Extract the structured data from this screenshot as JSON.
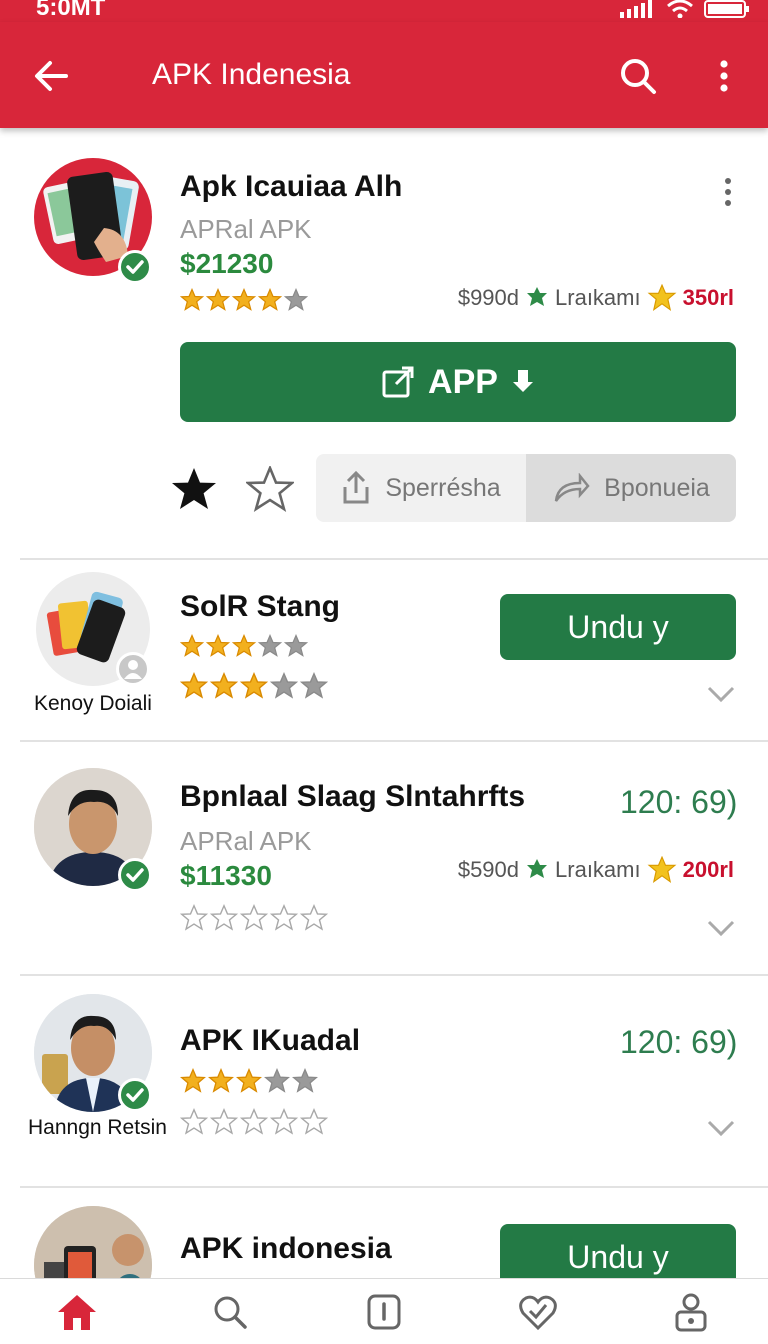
{
  "status_bar": {
    "time": "5:0MT"
  },
  "header": {
    "title": "APK Indenesia"
  },
  "featured": {
    "name": "Apk Icauiaa Alh",
    "subtitle": "APRal APK",
    "price": "$21230",
    "rating": 4,
    "meta_price": "$990d",
    "meta_tag": "Lraıkamı",
    "meta_count": "350rl",
    "primary_button": "APP",
    "action_left": "Sperrésha",
    "action_right": "Bponueia"
  },
  "items": [
    {
      "name": "SolR Stang",
      "caption": "Kenoy Doiali",
      "rating": 3,
      "rating2": 3,
      "button": "Undu y"
    },
    {
      "name": "Bpnlaal Slaag Slntahrfts",
      "subtitle": "APRal APK",
      "price": "$11330",
      "count": "120: 69)",
      "meta_price": "$590d",
      "meta_tag": "Lraıkamı",
      "meta_count": "200rl",
      "rating": 0
    },
    {
      "name": "APK IKuadal",
      "caption": "Hanngn Retsin",
      "count": "120: 69)",
      "rating": 3,
      "rating2": 0
    },
    {
      "name": "APK indonesia",
      "button": "Undu y"
    }
  ],
  "colors": {
    "brand_red": "#d8263a",
    "action_green": "#237a45",
    "star_gold": "#f2b01e"
  },
  "icons": [
    "arrow-left-icon",
    "search-icon",
    "more-vert-icon",
    "verified-check-icon",
    "share-icon",
    "forward-icon",
    "home-icon",
    "info-icon",
    "heart-check-icon",
    "lock-user-icon"
  ]
}
